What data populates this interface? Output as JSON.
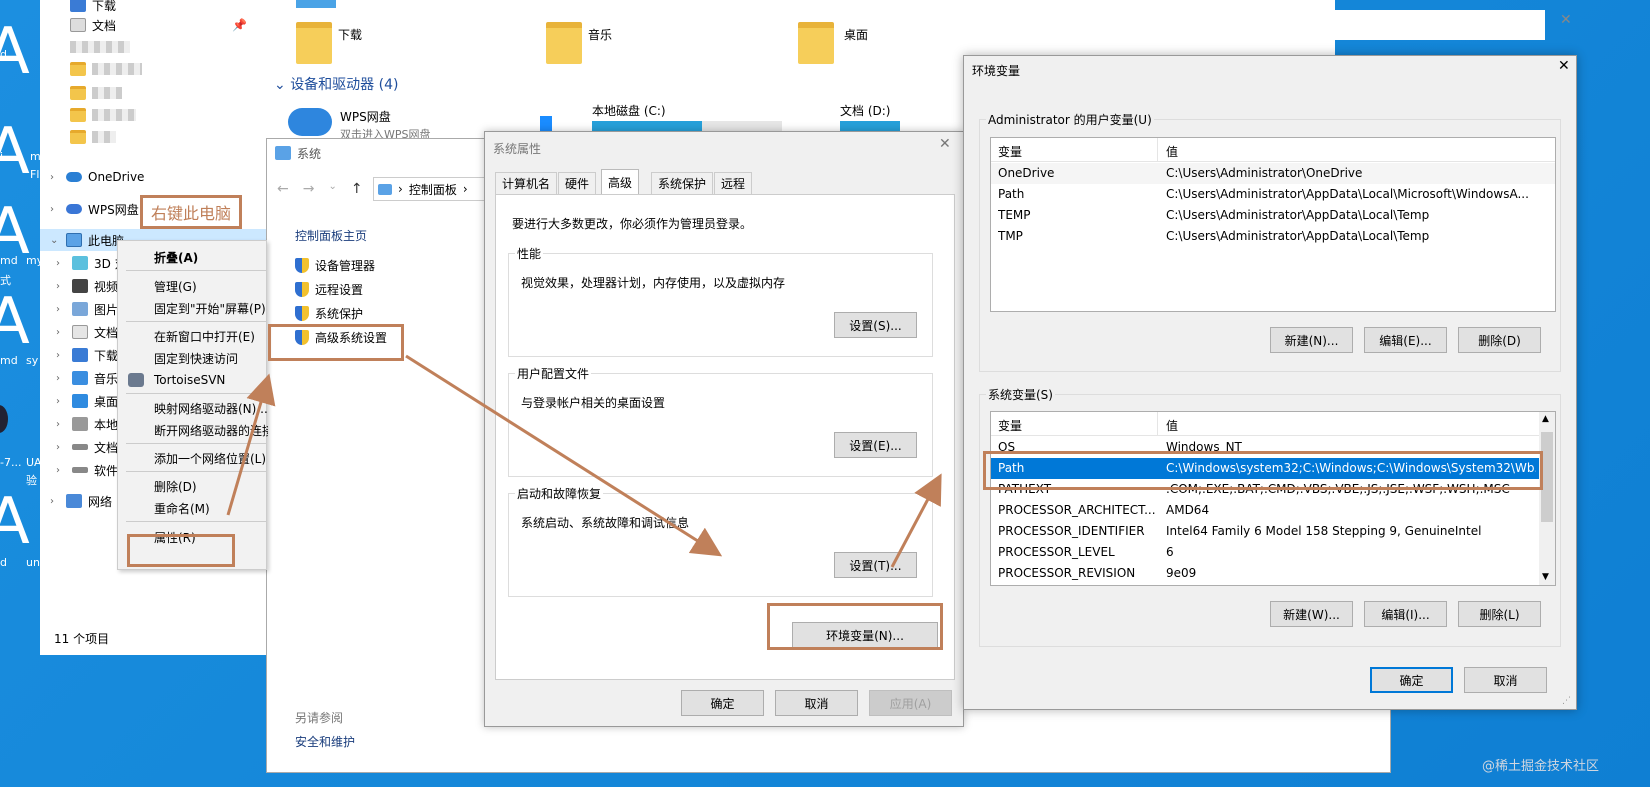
{
  "desktop": {
    "left_fragments": [
      "d",
      "i",
      "m",
      "Fl",
      "md",
      "my",
      "式",
      "md",
      "sy",
      "-7...",
      "UA",
      "验",
      "d",
      "un"
    ]
  },
  "explorer": {
    "nav": {
      "download": "下载",
      "documents": "文档",
      "onedrive": "OneDrive",
      "wps": "WPS网盘",
      "this_pc": "此电脑",
      "objects3d": "3D 对",
      "videos": "视频",
      "pictures": "图片",
      "docs": "文档",
      "downloads2": "下载",
      "music": "音乐",
      "desktop": "桌面",
      "local": "本地",
      "docs2": "文档",
      "software": "软件",
      "network": "网络"
    },
    "folders": {
      "download": "下载",
      "music": "音乐",
      "desktop": "桌面"
    },
    "devices_header": "设备和驱动器 (4)",
    "wps_drive": "WPS网盘",
    "wps_drive_sub": "双击进入WPS网盘",
    "local_disk": "本地磁盘 (C:)",
    "docs_disk": "文档 (D:)",
    "status": "11 个项目"
  },
  "annotation": {
    "right_click_label": "右键此电脑"
  },
  "context_menu": {
    "items": [
      "折叠(A)",
      "管理(G)",
      "固定到\"开始\"屏幕(P)",
      "在新窗口中打开(E)",
      "固定到快速访问",
      "TortoiseSVN",
      "映射网络驱动器(N)...",
      "断开网络驱动器的连接",
      "添加一个网络位置(L)",
      "删除(D)",
      "重命名(M)",
      "属性(R)"
    ]
  },
  "system_window": {
    "title": "系统",
    "breadcrumb": "控制面板",
    "home_link": "控制面板主页",
    "links": [
      "设备管理器",
      "远程设置",
      "系统保护",
      "高级系统设置"
    ],
    "see_also": "另请参阅",
    "security": "安全和维护"
  },
  "system_properties": {
    "title": "系统属性",
    "tabs": [
      "计算机名",
      "硬件",
      "高级",
      "系统保护",
      "远程"
    ],
    "admin_note": "要进行大多数更改，你必须作为管理员登录。",
    "performance": {
      "title": "性能",
      "desc": "视觉效果，处理器计划，内存使用，以及虚拟内存",
      "button": "设置(S)..."
    },
    "profiles": {
      "title": "用户配置文件",
      "desc": "与登录帐户相关的桌面设置",
      "button": "设置(E)..."
    },
    "startup": {
      "title": "启动和故障恢复",
      "desc": "系统启动、系统故障和调试信息",
      "button": "设置(T)..."
    },
    "env_button": "环境变量(N)...",
    "ok": "确定",
    "cancel": "取消",
    "apply": "应用(A)"
  },
  "env_vars": {
    "title": "环境变量",
    "user_group": "Administrator 的用户变量(U)",
    "col_var": "变量",
    "col_val": "值",
    "user_rows": [
      {
        "name": "OneDrive",
        "value": "C:\\Users\\Administrator\\OneDrive"
      },
      {
        "name": "Path",
        "value": "C:\\Users\\Administrator\\AppData\\Local\\Microsoft\\WindowsA..."
      },
      {
        "name": "TEMP",
        "value": "C:\\Users\\Administrator\\AppData\\Local\\Temp"
      },
      {
        "name": "TMP",
        "value": "C:\\Users\\Administrator\\AppData\\Local\\Temp"
      }
    ],
    "user_buttons": [
      "新建(N)...",
      "编辑(E)...",
      "删除(D)"
    ],
    "sys_group": "系统变量(S)",
    "sys_rows": [
      {
        "name": "OS",
        "value": "Windows_NT"
      },
      {
        "name": "Path",
        "value": "C:\\Windows\\system32;C:\\Windows;C:\\Windows\\System32\\Wb..."
      },
      {
        "name": "PATHEXT",
        "value": ".COM;.EXE;.BAT;.CMD;.VBS;.VBE;.JS;.JSE;.WSF;.WSH;.MSC"
      },
      {
        "name": "PROCESSOR_ARCHITECT...",
        "value": "AMD64"
      },
      {
        "name": "PROCESSOR_IDENTIFIER",
        "value": "Intel64 Family 6 Model 158 Stepping 9, GenuineIntel"
      },
      {
        "name": "PROCESSOR_LEVEL",
        "value": "6"
      },
      {
        "name": "PROCESSOR_REVISION",
        "value": "9e09"
      }
    ],
    "sys_buttons": [
      "新建(W)...",
      "编辑(I)...",
      "删除(L)"
    ],
    "ok": "确定",
    "cancel": "取消"
  },
  "watermark": "@稀土掘金技术社区",
  "colors": {
    "annotation": "#c0805a",
    "selection": "#0078d7",
    "desktop": "#1689da"
  }
}
